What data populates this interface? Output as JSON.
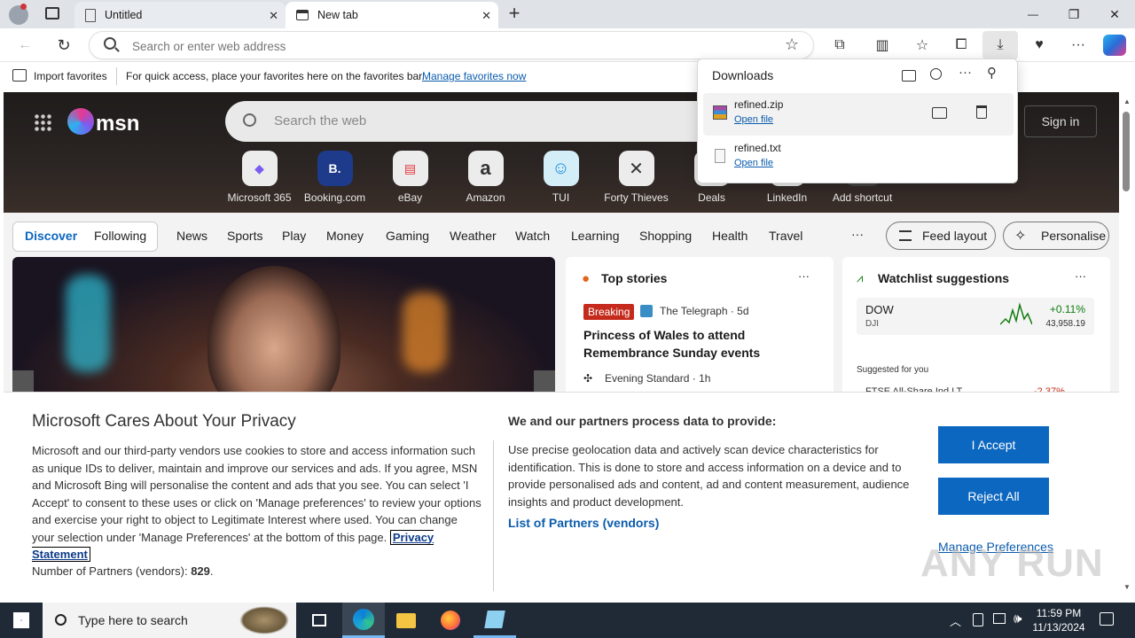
{
  "tabs": [
    {
      "label": "Untitled",
      "close": "✕"
    },
    {
      "label": "New tab",
      "close": "✕"
    }
  ],
  "newtab": "+",
  "window": {
    "minimize": "—",
    "restore": "❐",
    "close": "✕"
  },
  "address": {
    "placeholder": "Search or enter web address"
  },
  "favbar": {
    "import": "Import favorites",
    "hint": "For quick access, place your favorites here on the favorites bar.",
    "manage": "Manage favorites now"
  },
  "msn": {
    "logo": "msn",
    "search_placeholder": "Search the web",
    "signin": "Sign in"
  },
  "shortcuts": [
    {
      "label": "Microsoft 365",
      "glyph": "◆"
    },
    {
      "label": "Booking.com",
      "glyph": "B."
    },
    {
      "label": "eBay",
      "glyph": "▤"
    },
    {
      "label": "Amazon",
      "glyph": "a"
    },
    {
      "label": "TUI",
      "glyph": "☺"
    },
    {
      "label": "Forty Thieves",
      "glyph": "✕"
    },
    {
      "label": "Deals",
      "glyph": ""
    },
    {
      "label": "LinkedIn",
      "glyph": ""
    },
    {
      "label": "Add shortcut",
      "glyph": ""
    }
  ],
  "nav": {
    "discover": "Discover",
    "following": "Following",
    "items": [
      "News",
      "Sports",
      "Play",
      "Money",
      "Gaming",
      "Weather",
      "Watch",
      "Learning",
      "Shopping",
      "Health",
      "Travel"
    ],
    "more": "···",
    "feed_layout": "Feed layout",
    "personalise": "Personalise"
  },
  "top_stories": {
    "title": "Top stories",
    "more": "···",
    "badge": "Breaking",
    "source": "The Telegraph · 5d",
    "headline": "Princess of Wales to attend Remembrance Sunday events",
    "source2": "Evening Standard · 1h"
  },
  "watchlist": {
    "title": "Watchlist suggestions",
    "more": "···",
    "ticker": "DOW",
    "sub": "DJI",
    "change": "+0.11%",
    "value": "43,958.19",
    "suggested": "Suggested for you",
    "next": "FTSE All-Share Ind LT",
    "next_change": "-2.37%"
  },
  "downloads": {
    "title": "Downloads",
    "items": [
      {
        "name": "refined.zip",
        "action": "Open file"
      },
      {
        "name": "refined.txt",
        "action": "Open file"
      }
    ]
  },
  "privacy": {
    "title": "Microsoft Cares About Your Privacy",
    "body": "Microsoft and our third-party vendors use cookies to store and access information such as unique IDs to deliver, maintain and improve our services and ads. If you agree, MSN and Microsoft Bing will personalise the content and ads that you see. You can select 'I Accept' to consent to these uses or click on 'Manage preferences' to review your options and exercise your right to object to Legitimate Interest where used.  You can change your selection under 'Manage Preferences' at the bottom of this page.",
    "statement": "Privacy Statement",
    "partners_label": "Number of Partners (vendors):",
    "partners_count": "829",
    "right_title": "We and our partners process data to provide:",
    "right_body": "Use precise geolocation data and actively scan device characteristics for identification. This is done to store and access information on a device and to provide personalised ads and content, ad and content measurement, audience insights and product development.",
    "list_link": "List of Partners (vendors)",
    "accept": "I Accept",
    "reject": "Reject All",
    "manage": "Manage Preferences"
  },
  "watermark": "ANY RUN",
  "taskbar": {
    "search_placeholder": "Type here to search",
    "time": "11:59 PM",
    "date": "11/13/2024"
  },
  "colors": {
    "accent": "#0c67c0",
    "breaking": "#c42b1c",
    "positive": "#107c10",
    "negative": "#c42b1c",
    "link": "#0b5cad"
  }
}
